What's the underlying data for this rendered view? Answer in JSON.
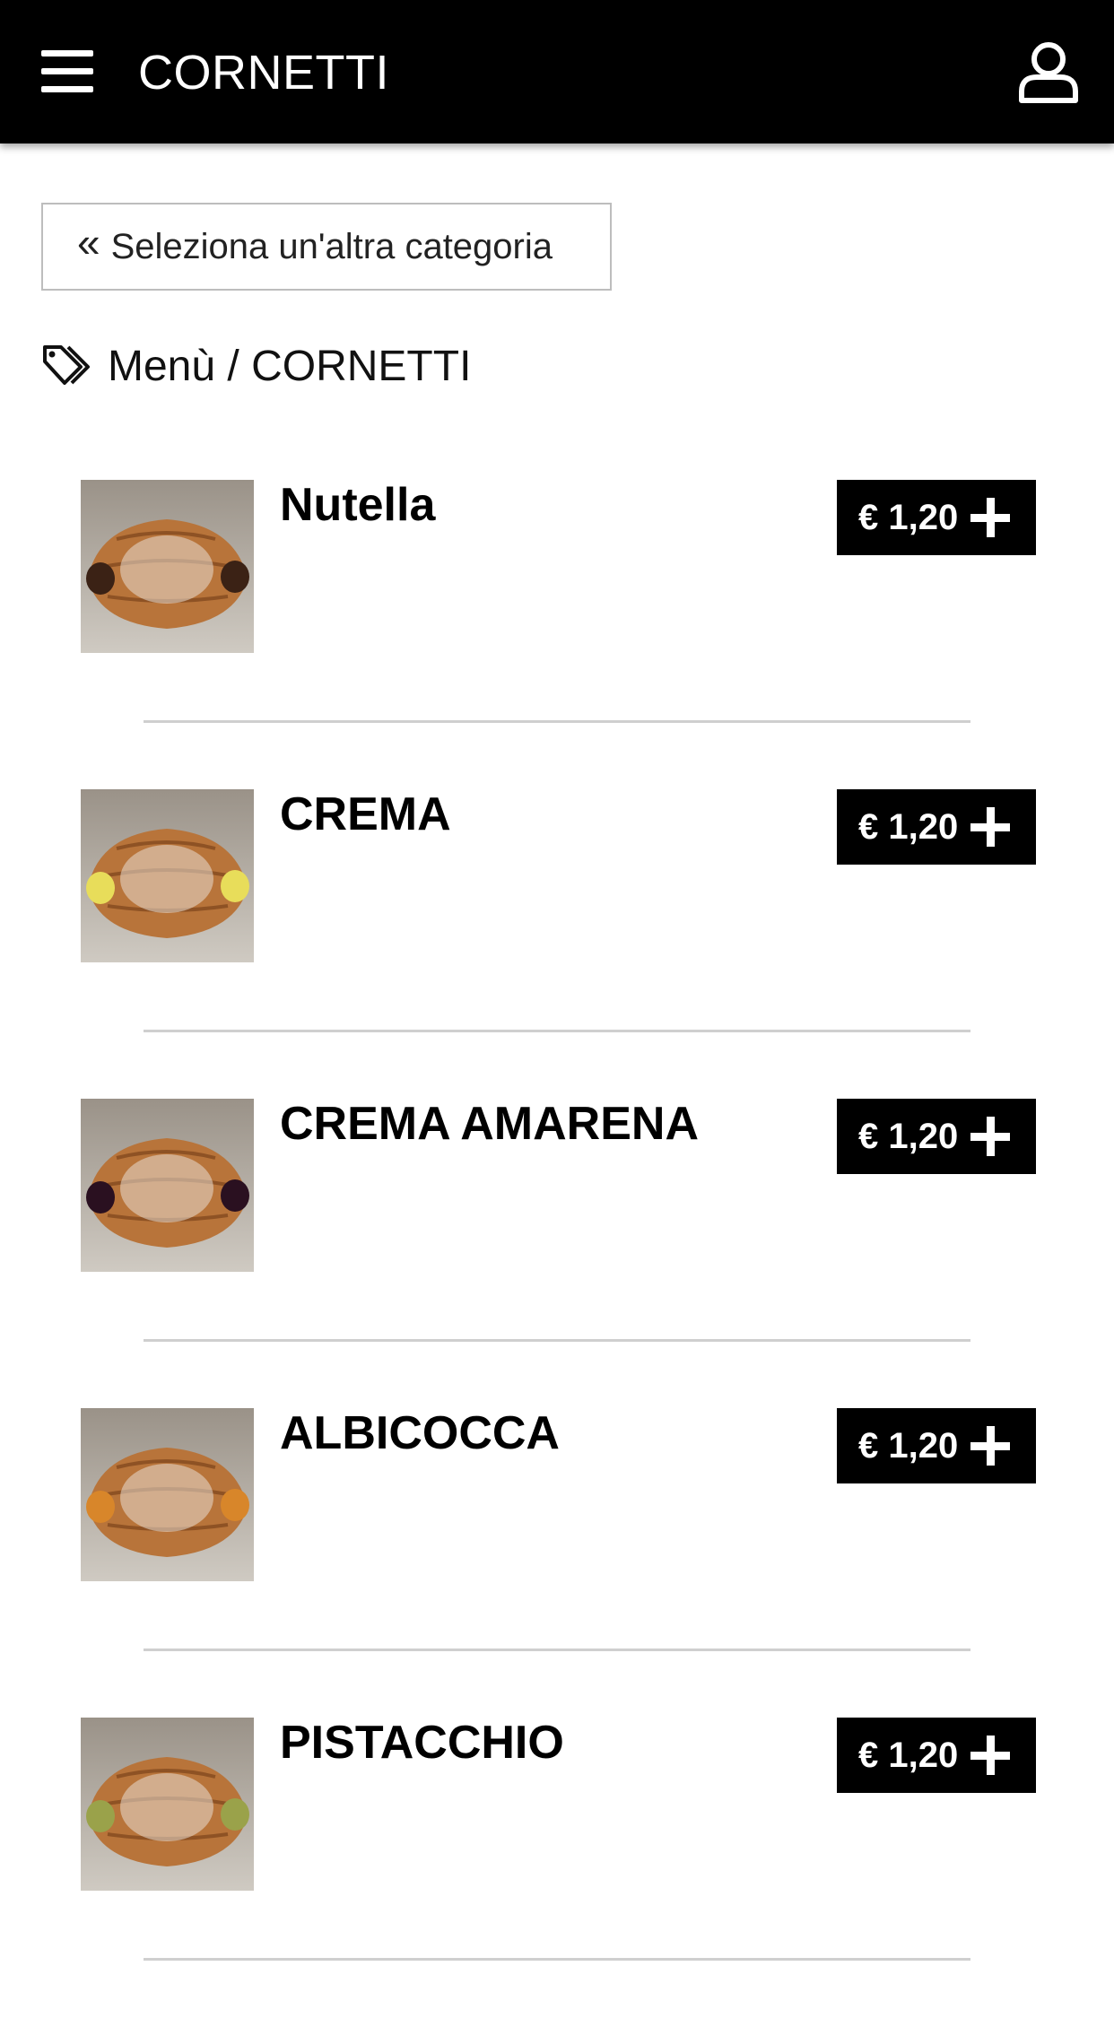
{
  "header": {
    "title": "CORNETTI"
  },
  "back_button": {
    "label": "Seleziona un'altra categoria"
  },
  "breadcrumb": {
    "text": "Menù / CORNETTI"
  },
  "products": [
    {
      "name": "Nutella",
      "price": "€ 1,20",
      "filling_color": "#3b2215"
    },
    {
      "name": "CREMA",
      "price": "€ 1,20",
      "filling_color": "#e8dd5a"
    },
    {
      "name": "CREMA AMARENA",
      "price": "€ 1,20",
      "filling_color": "#2a1020"
    },
    {
      "name": "ALBICOCCA",
      "price": "€ 1,20",
      "filling_color": "#d8862a"
    },
    {
      "name": "PISTACCHIO",
      "price": "€ 1,20",
      "filling_color": "#9aa24a"
    }
  ],
  "colors": {
    "header_bg": "#000000",
    "button_bg": "#000000",
    "divider": "#cfcfcf"
  },
  "icons": {
    "menu": "hamburger-icon",
    "user": "user-icon",
    "back": "double-chevron-left-icon",
    "tag": "tags-icon",
    "add": "plus-icon"
  }
}
